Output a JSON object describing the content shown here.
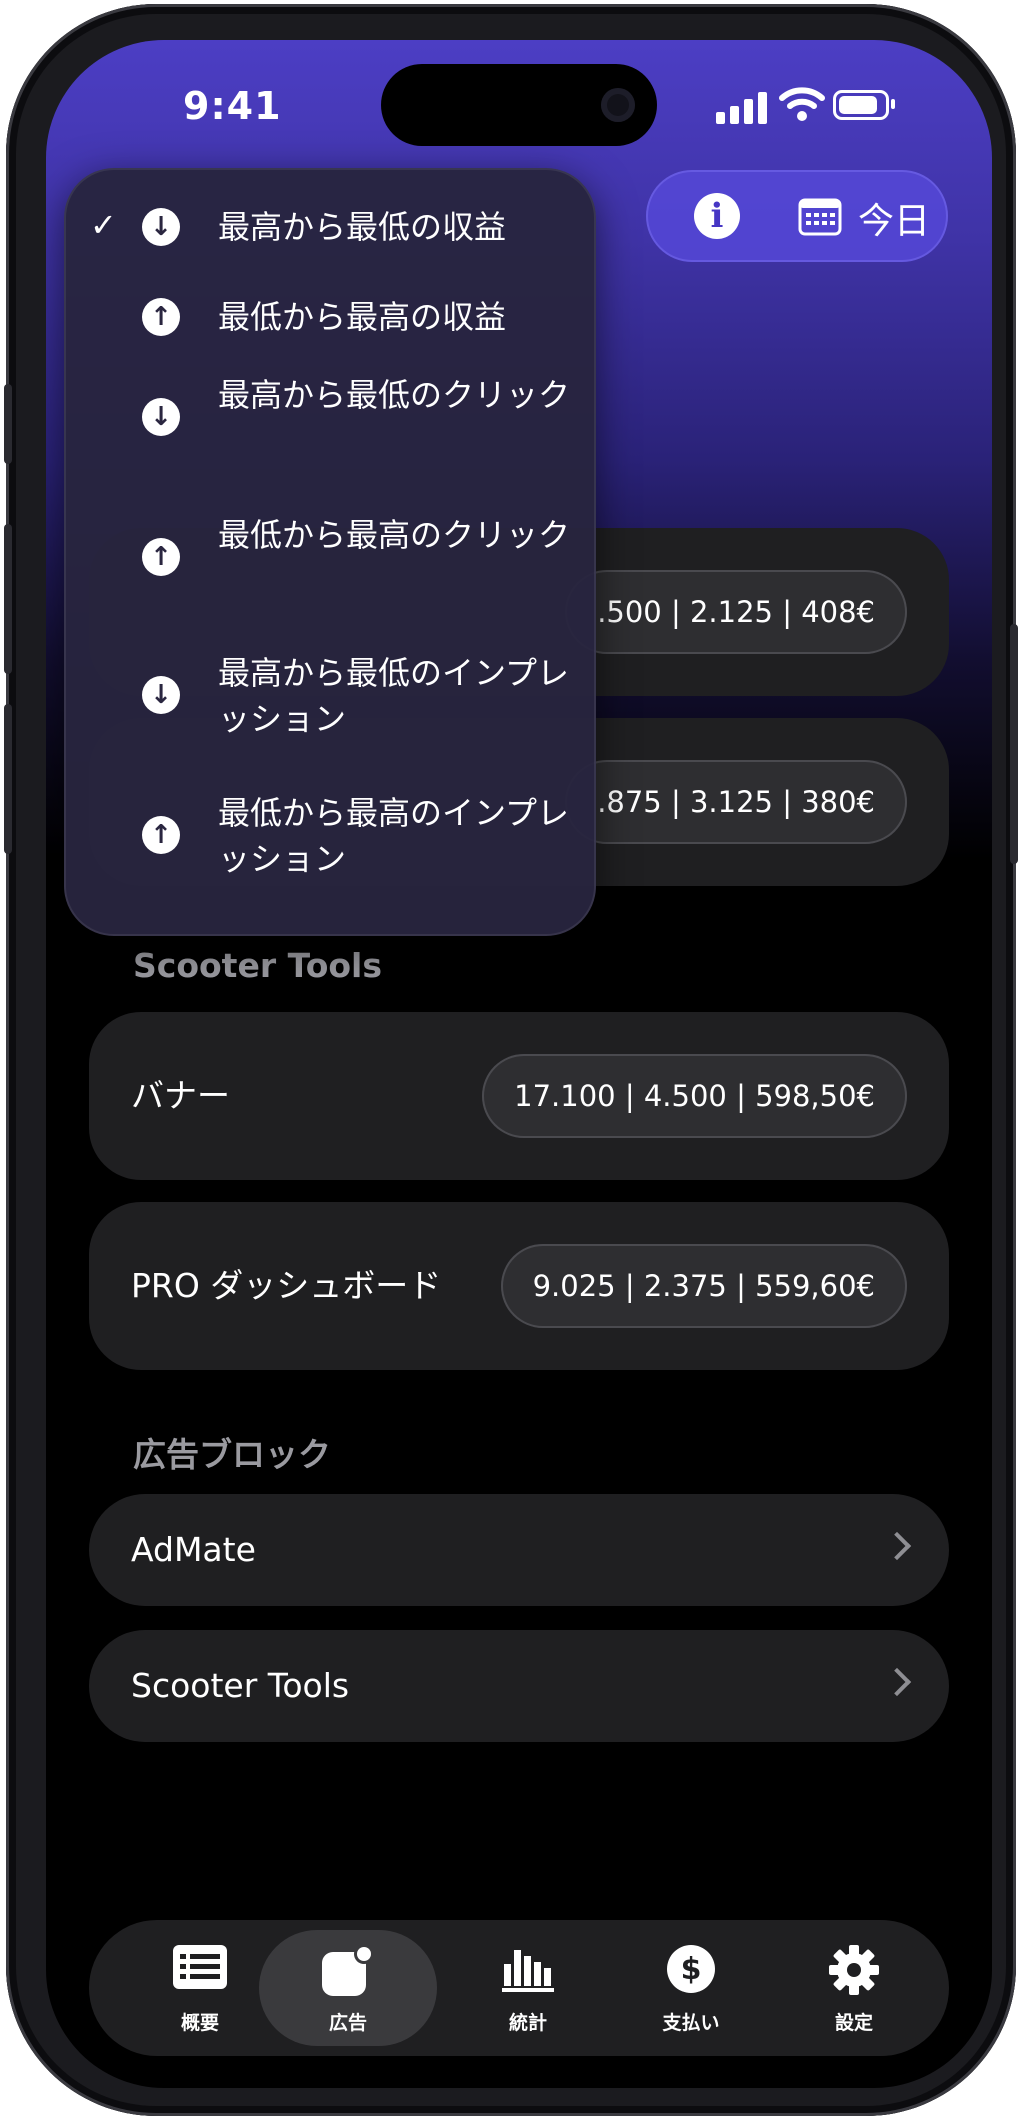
{
  "status_bar": {
    "time": "9:41"
  },
  "top_bar": {
    "today_label": "今日"
  },
  "sort_menu": {
    "items": [
      {
        "label": "最高から最低の収益",
        "direction": "down",
        "selected": true,
        "check": "✓",
        "arrow": "↓"
      },
      {
        "label": "最低から最高の収益",
        "direction": "up",
        "selected": false,
        "check": "",
        "arrow": "↑"
      },
      {
        "label": "最高から最低のクリック",
        "direction": "down",
        "selected": false,
        "check": "",
        "arrow": "↓"
      },
      {
        "label": "最低から最高のクリック",
        "direction": "up",
        "selected": false,
        "check": "",
        "arrow": "↑"
      },
      {
        "label": "最高から最低のインプレッション",
        "direction": "down",
        "selected": false,
        "check": "",
        "arrow": "↓"
      },
      {
        "label": "最低から最高のインプレッション",
        "direction": "up",
        "selected": false,
        "check": "",
        "arrow": "↑"
      }
    ]
  },
  "partial_cards": [
    {
      "stats": ".500 | 2.125 | 408€"
    },
    {
      "stats": ".875 | 3.125 | 380€"
    }
  ],
  "scooter_section": {
    "title": "Scooter Tools",
    "items": [
      {
        "label": "バナー",
        "stats": "17.100 | 4.500 | 598,50€"
      },
      {
        "label": "PRO ダッシュボード",
        "stats": "9.025 | 2.375 | 559,60€"
      }
    ]
  },
  "ad_blocks": {
    "title": "広告ブロック",
    "items": [
      {
        "label": "AdMate"
      },
      {
        "label": "Scooter Tools"
      }
    ]
  },
  "tab_bar": {
    "tabs": [
      {
        "label": "概要",
        "icon": "list-icon",
        "active": false
      },
      {
        "label": "広告",
        "icon": "ad-badge-icon",
        "active": true
      },
      {
        "label": "統計",
        "icon": "bar-chart-icon",
        "active": false
      },
      {
        "label": "支払い",
        "icon": "dollar-icon",
        "active": false
      },
      {
        "label": "設定",
        "icon": "gear-icon",
        "active": false
      }
    ]
  }
}
